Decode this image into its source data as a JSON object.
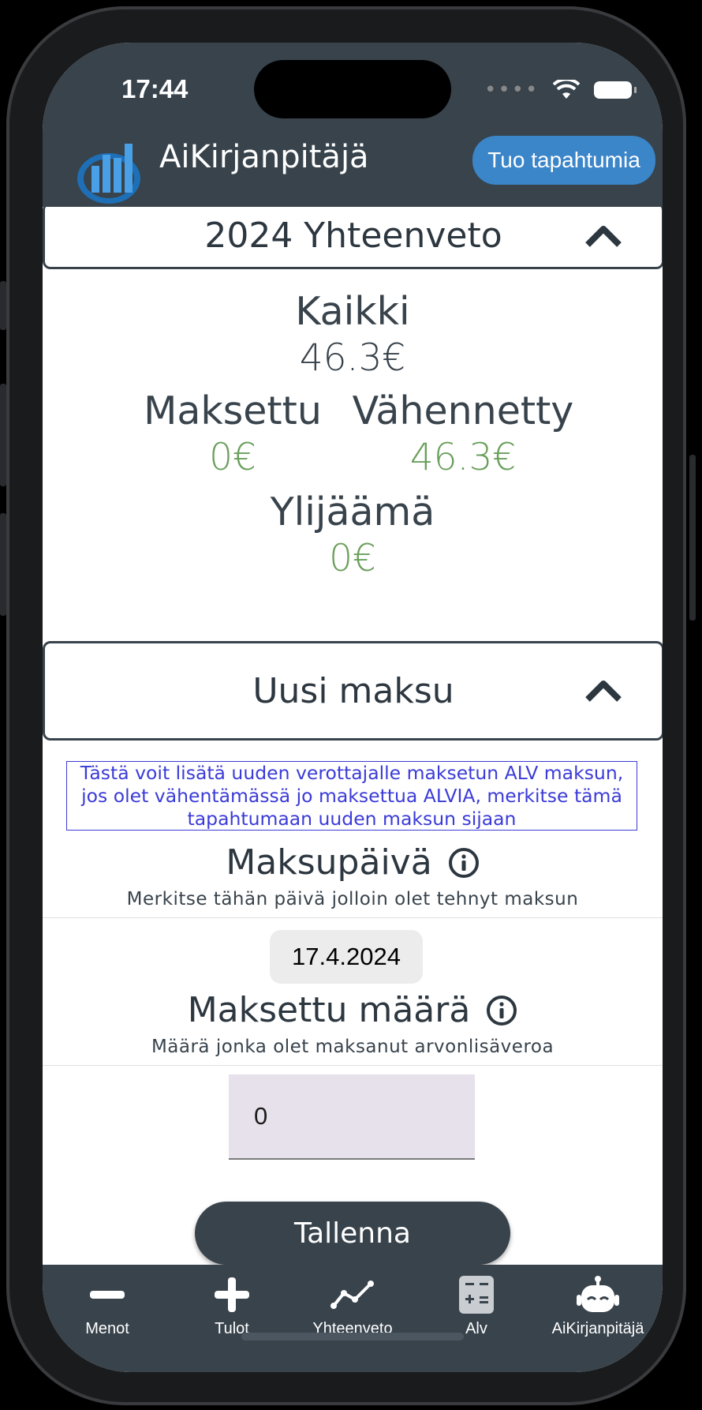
{
  "status": {
    "time": "17:44"
  },
  "header": {
    "app_title": "AiKirjanpitäjä",
    "import_label": "Tuo tapahtumia"
  },
  "summary": {
    "title": "2024 Yhteenveto",
    "all_label": "Kaikki",
    "all_value": "46.3€",
    "paid_label": "Maksettu",
    "paid_value": "0€",
    "deducted_label": "Vähennetty",
    "deducted_value": "46.3€",
    "surplus_label": "Ylijäämä",
    "surplus_value": "0€",
    "value_color": "#6a9f5b"
  },
  "new_payment": {
    "title": "Uusi maksu",
    "note_line1": "Tästä voit lisätä uuden verottajalle maksetun ALV maksun,",
    "note_line2": "jos olet vähentämässä jo maksettua ALVIA, merkitse tämä",
    "note_line3": "tapahtumaan uuden maksun sijaan",
    "date_label": "Maksupäivä",
    "date_hint": "Merkitse tähän päivä jolloin olet tehnyt maksun",
    "date_value": "17.4.2024",
    "amount_label": "Maksettu määrä",
    "amount_hint": "Määrä jonka olet maksanut arvonlisäveroa",
    "amount_value": "0",
    "save_label": "Tallenna"
  },
  "tabs": [
    {
      "label": "Menot",
      "icon": "minus-icon"
    },
    {
      "label": "Tulot",
      "icon": "plus-icon"
    },
    {
      "label": "Yhteenveto",
      "icon": "line-chart-icon"
    },
    {
      "label": "Alv",
      "icon": "calculator-icon"
    },
    {
      "label": "AiKirjanpitäjä",
      "icon": "robot-icon"
    }
  ],
  "colors": {
    "primary": "#38434c",
    "accent": "#3b85c9",
    "note": "#3b3bd8"
  }
}
